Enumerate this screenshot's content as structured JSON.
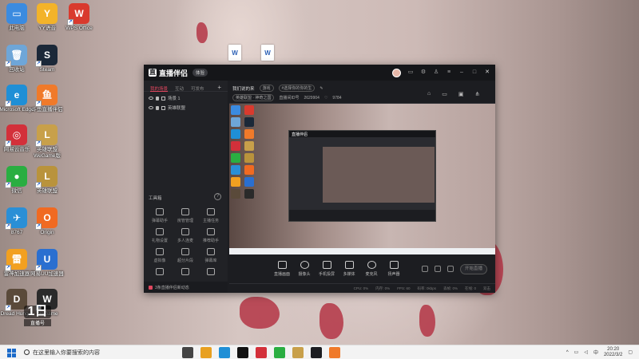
{
  "desktop": {
    "icons": [
      {
        "label": "此电脑",
        "color": "#3b8be0",
        "glyph": "▭"
      },
      {
        "label": "YY语音",
        "color": "#f3b32a",
        "glyph": "Y"
      },
      {
        "label": "WPS Office",
        "color": "#d93a2e",
        "glyph": "W"
      },
      {
        "label": "回收站",
        "color": "#6ea6d8",
        "glyph": "🗑"
      },
      {
        "label": "Steam",
        "color": "#1b2838",
        "glyph": "S"
      },
      {
        "label": "Microsoft Edge",
        "color": "#1f8fd6",
        "glyph": "e"
      },
      {
        "label": "斗鱼直播伴侣",
        "color": "#f07a2a",
        "glyph": "鱼"
      },
      {
        "label": "网易云音乐",
        "color": "#d3303a",
        "glyph": "◎"
      },
      {
        "label": "英雄联盟 WeGame版",
        "color": "#c8a04a",
        "glyph": "L"
      },
      {
        "label": "微信",
        "color": "#2aae41",
        "glyph": "●"
      },
      {
        "label": "英雄联盟",
        "color": "#b9933c",
        "glyph": "L"
      },
      {
        "label": "8767",
        "color": "#2a8fd6",
        "glyph": "✈"
      },
      {
        "label": "Origin",
        "color": "#f06a22",
        "glyph": "O"
      },
      {
        "label": "雷神加速器",
        "color": "#f2a020",
        "glyph": "雷"
      },
      {
        "label": "网易UU加速器",
        "color": "#2a6fd0",
        "glyph": "U"
      },
      {
        "label": "Dread Hunger",
        "color": "#5a4a3a",
        "glyph": "D"
      },
      {
        "label": "WeGame",
        "color": "#2a2a2a",
        "glyph": "W"
      }
    ]
  },
  "app": {
    "logo": "直播伴侣",
    "badge": "体验",
    "tabs": [
      "我的场景",
      "互动",
      "可发布"
    ],
    "scenes": [
      "场景 1",
      "英雄联盟"
    ],
    "toolbox_title": "工具箱",
    "tools": [
      "弹幕助手",
      "房管管理",
      "主播任务",
      "礼物设置",
      "多人连麦",
      "推荐助手",
      "虚拟像",
      "超分片段",
      "弹幕库",
      "",
      "",
      ""
    ],
    "notice": "3条直播伴侣新动态",
    "stream_title": "我们说的来",
    "category": "游戏",
    "tag1": "#选择你的你的生",
    "game_label": "英雄联盟 · 神奇之国",
    "room_label": "直播间ID号",
    "room_id": "2629904",
    "fans": "9784",
    "controls": [
      "直播画面",
      "摄像头",
      "手机投屏",
      "多媒体",
      "麦克风",
      "扬声器"
    ],
    "start_button": "开始直播",
    "status": [
      "CPU: 0%",
      "内存: 0%",
      "FPS: 60",
      "码率: 0kbps",
      "丢帧: 0%",
      "在线: 0",
      "双击"
    ]
  },
  "watermark": {
    "big": "1日",
    "small": "直播号"
  },
  "taskbar": {
    "search_placeholder": "在这里输入你要搜索的内容",
    "time": "20:20",
    "date": "2022/3/2",
    "apps": [
      "#444",
      "#e8a020",
      "#1f8fd6",
      "#111",
      "#d3303a",
      "#2aae41",
      "#c8a04a",
      "#1c1d21",
      "#f07a2a"
    ]
  }
}
